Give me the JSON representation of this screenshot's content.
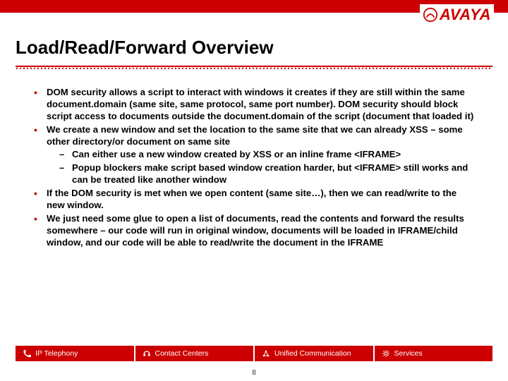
{
  "brand": {
    "name": "AVAYA"
  },
  "title": "Load/Read/Forward Overview",
  "bullets": [
    {
      "text": "DOM security allows a script to interact with windows it creates if they are still within the same document.domain (same site, same protocol, same port number). DOM security should block script access to documents outside the document.domain of the script (document that loaded it)"
    },
    {
      "text": "We create a new window and set the location to the same site that we can already XSS – some other directory/or document on same site",
      "sub": [
        "Can either use a new window created by XSS or an inline frame <IFRAME>",
        "Popup blockers make script based window creation harder, but <IFRAME> still works and can be treated like another window"
      ]
    },
    {
      "text": "If the DOM security is met when we open content (same site…), then we can read/write to the new window."
    },
    {
      "text": "We just need some glue to open a list of documents, read the contents and forward the results somewhere – our code will run in original window, documents will be loaded in IFRAME/child window, and our code will be able to read/write the document in the IFRAME"
    }
  ],
  "footer": {
    "items": [
      {
        "label": "IP Telephony"
      },
      {
        "label": "Contact Centers"
      },
      {
        "label": "Unified Communication"
      },
      {
        "label": "Services"
      }
    ]
  },
  "page_number": "8"
}
